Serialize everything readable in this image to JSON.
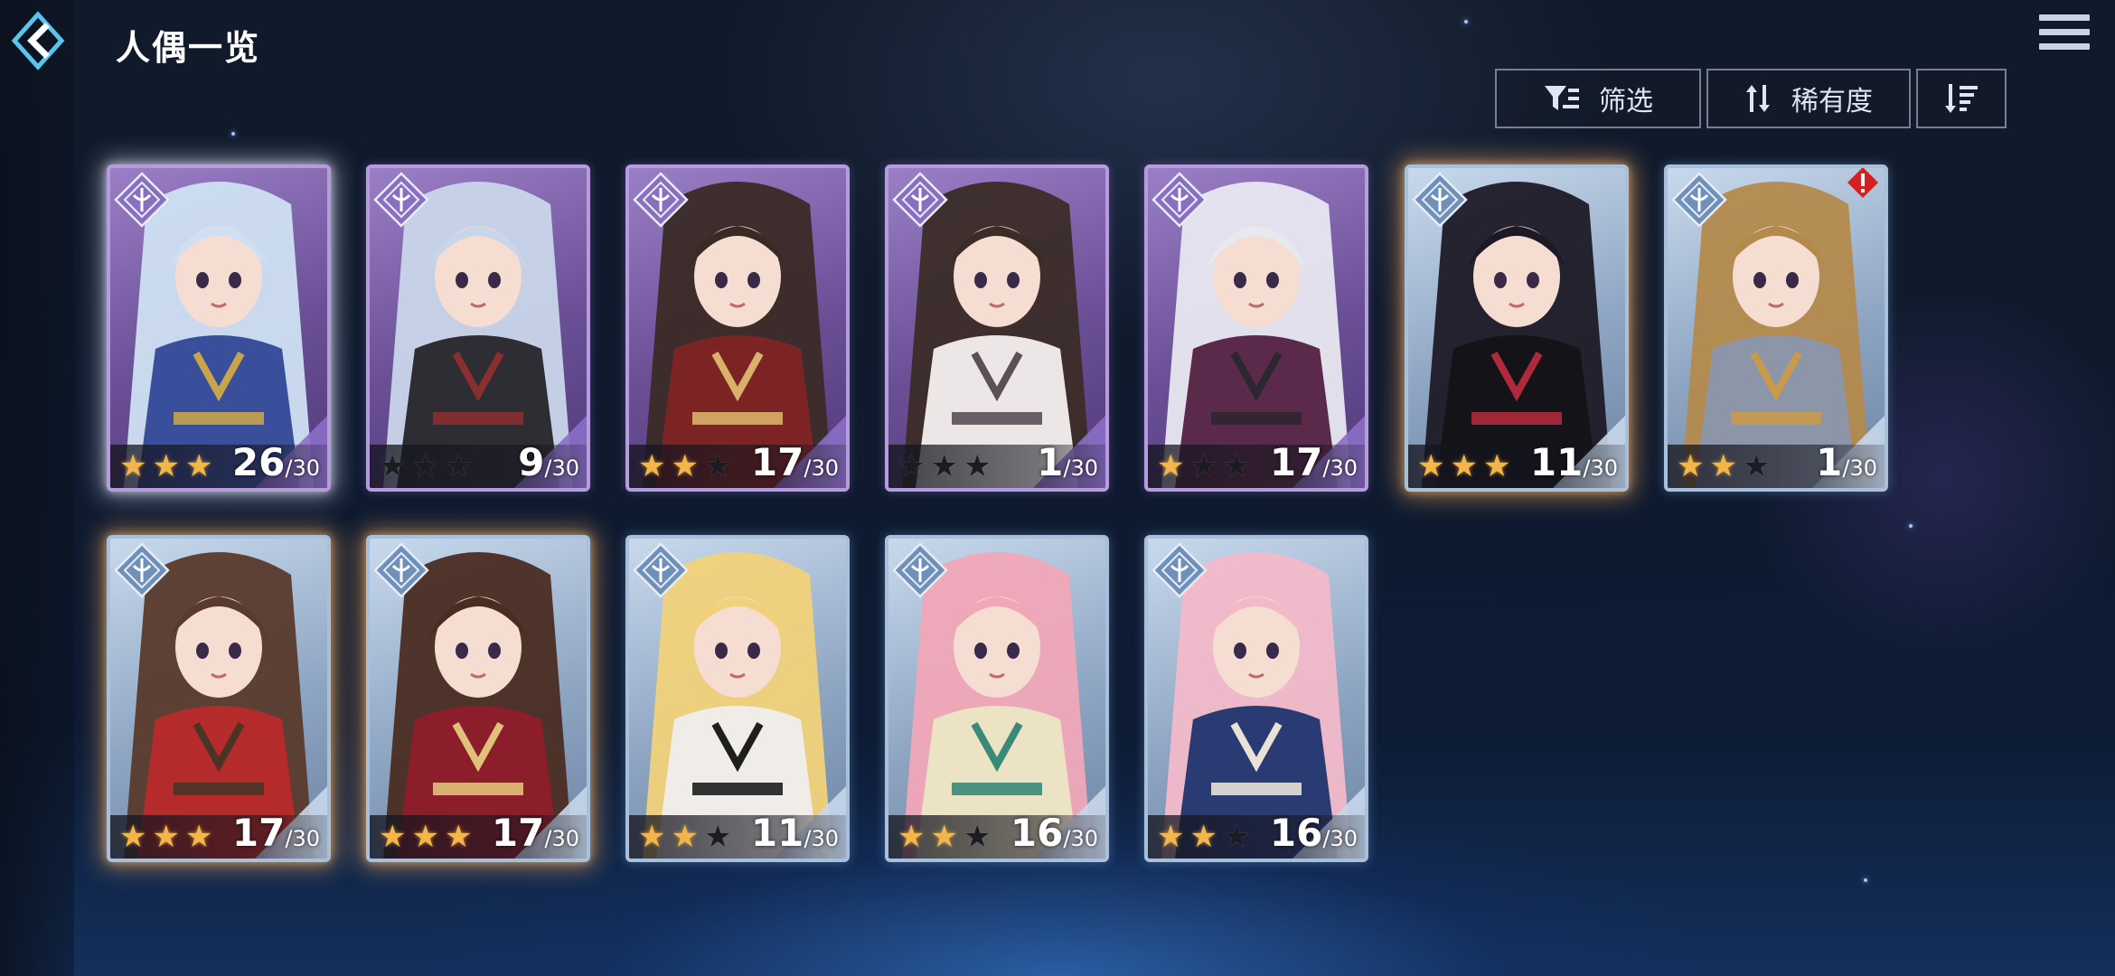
{
  "header": {
    "title": "人偶一览",
    "back_icon": "back-arrow-icon",
    "menu_icon": "hamburger-menu-icon"
  },
  "toolbar": {
    "filter_label": "筛选",
    "sort_label": "稀有度",
    "order_icon": "sort-descending-icon"
  },
  "colors": {
    "star_on": "#f2b64b",
    "star_off": "#1b1b22",
    "frame_purple": "#b59cdd",
    "frame_blue": "#a9c0dc",
    "alert": "#d62020"
  },
  "cards": [
    {
      "frame": "purple",
      "stars": 3,
      "level": "26",
      "max": "/30",
      "hair": "#cfe0f2",
      "outfit": "#3a4f9c",
      "accent": "#c8a44a",
      "glow": "white",
      "alert": false
    },
    {
      "frame": "purple",
      "stars": 0,
      "level": "9",
      "max": "/30",
      "hair": "#c9d6ea",
      "outfit": "#2d2d33",
      "accent": "#8a2f2f",
      "glow": "",
      "alert": false
    },
    {
      "frame": "purple",
      "stars": 2,
      "level": "17",
      "max": "/30",
      "hair": "#3a2a26",
      "outfit": "#7c2424",
      "accent": "#d9b16a",
      "glow": "",
      "alert": false
    },
    {
      "frame": "purple",
      "stars": 0,
      "level": "1",
      "max": "/30",
      "hair": "#3b2c28",
      "outfit": "#ece6e6",
      "accent": "#5a5058",
      "glow": "",
      "alert": false
    },
    {
      "frame": "purple",
      "stars": 1,
      "level": "17",
      "max": "/30",
      "hair": "#e8e8f0",
      "outfit": "#5b2a4a",
      "accent": "#2c2630",
      "glow": "",
      "alert": false
    },
    {
      "frame": "blue",
      "stars": 3,
      "level": "11",
      "max": "/30",
      "hair": "#1d1a26",
      "outfit": "#141418",
      "accent": "#b0283c",
      "glow": "gold",
      "alert": false
    },
    {
      "frame": "blue",
      "stars": 2,
      "level": "1",
      "max": "/30",
      "hair": "#b48a4c",
      "outfit": "#8c96a8",
      "accent": "#c89a4a",
      "glow": "",
      "alert": true
    },
    {
      "frame": "blue",
      "stars": 3,
      "level": "17",
      "max": "/30",
      "hair": "#5a3a2c",
      "outfit": "#b52a2a",
      "accent": "#4a3426",
      "glow": "gold",
      "alert": false
    },
    {
      "frame": "blue",
      "stars": 3,
      "level": "17",
      "max": "/30",
      "hair": "#4a2c22",
      "outfit": "#8c1d2a",
      "accent": "#e1c07a",
      "glow": "gold",
      "alert": false
    },
    {
      "frame": "blue",
      "stars": 2,
      "level": "11",
      "max": "/30",
      "hair": "#f1d27a",
      "outfit": "#f0ece8",
      "accent": "#1e1e1e",
      "glow": "",
      "alert": false
    },
    {
      "frame": "blue",
      "stars": 2,
      "level": "16",
      "max": "/30",
      "hair": "#f0a8b8",
      "outfit": "#ece3c4",
      "accent": "#3a8a7a",
      "glow": "",
      "alert": false
    },
    {
      "frame": "blue",
      "stars": 2,
      "level": "16",
      "max": "/30",
      "hair": "#f2b9c9",
      "outfit": "#2a3a72",
      "accent": "#e8e2d8",
      "glow": "",
      "alert": false
    }
  ]
}
